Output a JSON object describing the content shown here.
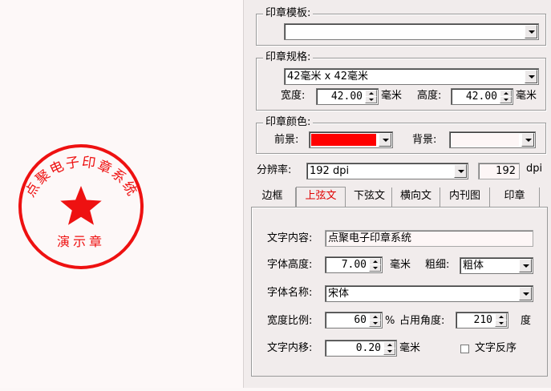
{
  "seal": {
    "outer_text": "点聚电子印章系统",
    "bottom_text": "演示章",
    "color": "#ee1111"
  },
  "template_group": {
    "title": "印章模板:",
    "value": ""
  },
  "spec_group": {
    "title": "印章规格:",
    "size_value": "42毫米 x 42毫米",
    "width_label": "宽度:",
    "width_value": "42.00",
    "height_label": "高度:",
    "height_value": "42.00",
    "unit": "毫米"
  },
  "color_group": {
    "title": "印章颜色:",
    "fore_label": "前景:",
    "fore_color": "#ff0000",
    "back_label": "背景:",
    "back_color": "#fdf6f6"
  },
  "resolution": {
    "label": "分辨率:",
    "value": "192 dpi",
    "number": "192",
    "unit": "dpi"
  },
  "tabs": [
    {
      "label": "边框"
    },
    {
      "label": "上弦文"
    },
    {
      "label": "下弦文"
    },
    {
      "label": "横向文"
    },
    {
      "label": "内刊图"
    },
    {
      "label": "印章"
    }
  ],
  "upper_text": {
    "content_label": "文字内容:",
    "content_value": "点聚电子印章系统",
    "font_height_label": "字体高度:",
    "font_height_value": "7.00",
    "unit_mm": "毫米",
    "weight_label": "粗细:",
    "weight_value": "粗体",
    "font_name_label": "字体名称:",
    "font_name_value": "宋体",
    "width_ratio_label": "宽度比例:",
    "width_ratio_value": "60",
    "percent": "%",
    "angle_label": "占用角度:",
    "angle_value": "210",
    "degree": "度",
    "inset_label": "文字内移:",
    "inset_value": "0.20",
    "reverse_label": "文字反序",
    "reverse_checked": false
  }
}
